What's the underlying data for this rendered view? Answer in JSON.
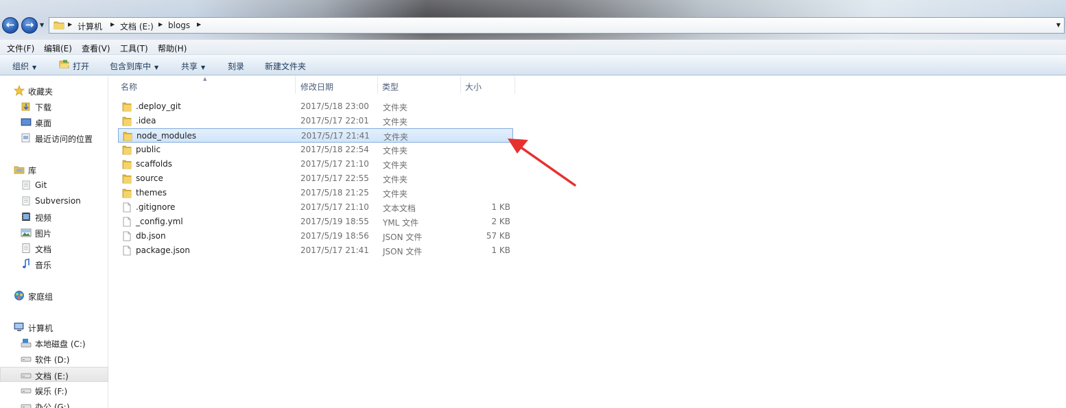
{
  "address": {
    "crumbs": [
      "计算机",
      "文档 (E:)",
      "blogs"
    ]
  },
  "menu": [
    "文件(F)",
    "编辑(E)",
    "查看(V)",
    "工具(T)",
    "帮助(H)"
  ],
  "commands": {
    "organize": "组织",
    "open": "打开",
    "include": "包含到库中",
    "share": "共享",
    "burn": "刻录",
    "new_folder": "新建文件夹"
  },
  "nav": {
    "favorites": "收藏夹",
    "downloads": "下载",
    "desktop": "桌面",
    "recent": "最近访问的位置",
    "libraries": "库",
    "git": "Git",
    "subversion": "Subversion",
    "videos": "视频",
    "pictures": "图片",
    "documents": "文档",
    "music": "音乐",
    "homegroup": "家庭组",
    "computer": "计算机",
    "drive_c": "本地磁盘 (C:)",
    "drive_d": "软件 (D:)",
    "drive_e": "文档 (E:)",
    "drive_f": "娱乐 (F:)",
    "drive_g": "办公 (G:)"
  },
  "columns": {
    "name": "名称",
    "modified": "修改日期",
    "type": "类型",
    "size": "大小"
  },
  "files": [
    {
      "name": ".deploy_git",
      "date": "2017/5/18 23:00",
      "type": "文件夹",
      "size": "",
      "kind": "folder"
    },
    {
      "name": ".idea",
      "date": "2017/5/17 22:01",
      "type": "文件夹",
      "size": "",
      "kind": "folder"
    },
    {
      "name": "node_modules",
      "date": "2017/5/17 21:41",
      "type": "文件夹",
      "size": "",
      "kind": "folder"
    },
    {
      "name": "public",
      "date": "2017/5/18 22:54",
      "type": "文件夹",
      "size": "",
      "kind": "folder"
    },
    {
      "name": "scaffolds",
      "date": "2017/5/17 21:10",
      "type": "文件夹",
      "size": "",
      "kind": "folder"
    },
    {
      "name": "source",
      "date": "2017/5/17 22:55",
      "type": "文件夹",
      "size": "",
      "kind": "folder"
    },
    {
      "name": "themes",
      "date": "2017/5/18 21:25",
      "type": "文件夹",
      "size": "",
      "kind": "folder"
    },
    {
      "name": ".gitignore",
      "date": "2017/5/17 21:10",
      "type": "文本文档",
      "size": "1 KB",
      "kind": "file"
    },
    {
      "name": "_config.yml",
      "date": "2017/5/19 18:55",
      "type": "YML 文件",
      "size": "2 KB",
      "kind": "file"
    },
    {
      "name": "db.json",
      "date": "2017/5/19 18:56",
      "type": "JSON 文件",
      "size": "57 KB",
      "kind": "file"
    },
    {
      "name": "package.json",
      "date": "2017/5/17 21:41",
      "type": "JSON 文件",
      "size": "1 KB",
      "kind": "file"
    }
  ],
  "colors": {
    "selection_border": "#84acdd",
    "annotation_arrow": "#e8302e"
  }
}
